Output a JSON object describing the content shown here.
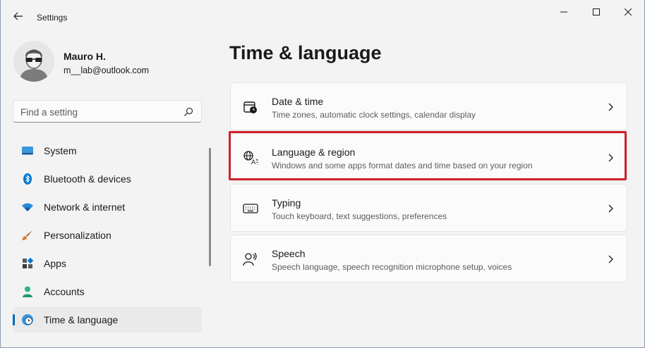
{
  "window": {
    "title": "Settings"
  },
  "profile": {
    "name": "Mauro H.",
    "email": "m__lab@outlook.com"
  },
  "search": {
    "placeholder": "Find a setting"
  },
  "sidebar": {
    "items": [
      {
        "label": "System",
        "icon": "monitor-icon"
      },
      {
        "label": "Bluetooth & devices",
        "icon": "bluetooth-icon"
      },
      {
        "label": "Network & internet",
        "icon": "wifi-icon"
      },
      {
        "label": "Personalization",
        "icon": "brush-icon"
      },
      {
        "label": "Apps",
        "icon": "apps-icon"
      },
      {
        "label": "Accounts",
        "icon": "account-icon"
      },
      {
        "label": "Time & language",
        "icon": "globe-clock-icon",
        "active": true
      }
    ]
  },
  "main": {
    "title": "Time & language",
    "cards": [
      {
        "title": "Date & time",
        "description": "Time zones, automatic clock settings, calendar display",
        "icon": "calendar-clock-icon"
      },
      {
        "title": "Language & region",
        "description": "Windows and some apps format dates and time based on your region",
        "icon": "language-icon",
        "highlighted": true
      },
      {
        "title": "Typing",
        "description": "Touch keyboard, text suggestions, preferences",
        "icon": "keyboard-icon"
      },
      {
        "title": "Speech",
        "description": "Speech language, speech recognition microphone setup, voices",
        "icon": "speech-icon"
      }
    ]
  },
  "colors": {
    "accent": "#0067c0",
    "highlight": "#d0202c",
    "background": "#f3f3f3",
    "card": "#fbfbfb"
  }
}
